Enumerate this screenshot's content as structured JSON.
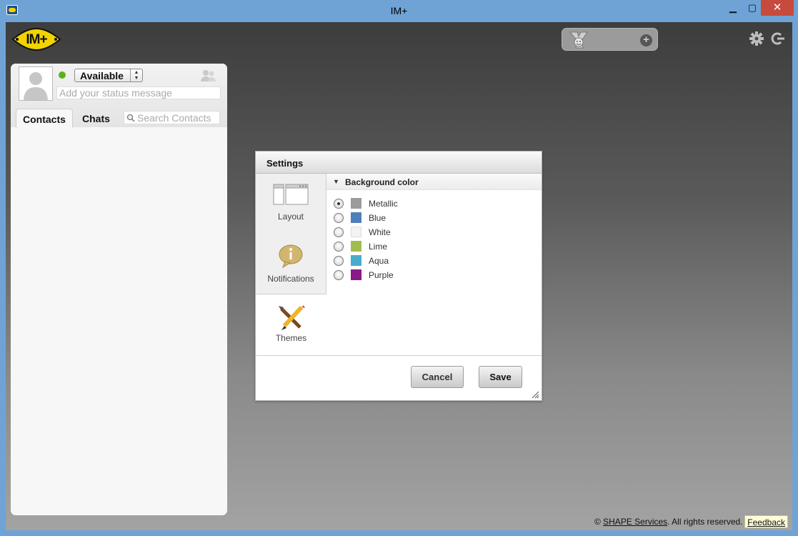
{
  "window": {
    "title": "IM+",
    "minimize_glyph": "▁",
    "maximize_glyph": "▢",
    "close_glyph": "✕"
  },
  "logo": {
    "text": "IM+"
  },
  "account": {
    "service_icon": "yahoo-messenger-icon",
    "add_icon": "plus-icon",
    "add_glyph": "+"
  },
  "toolbar": {
    "settings_icon": "gear-icon",
    "signout_icon": "signout-icon"
  },
  "profile": {
    "status": "Available",
    "status_color": "#5ab21b",
    "status_message_placeholder": "Add your status message"
  },
  "contacts_panel": {
    "tabs": [
      {
        "label": "Contacts",
        "active": true
      },
      {
        "label": "Chats",
        "active": false
      }
    ],
    "search_placeholder": "Search Contacts"
  },
  "settings": {
    "title": "Settings",
    "sidebar": [
      {
        "label": "Layout",
        "icon": "layout-icon"
      },
      {
        "label": "Notifications",
        "icon": "info-bubble-icon"
      },
      {
        "label": "Themes",
        "icon": "brush-pencil-icon",
        "active": true
      }
    ],
    "section_title": "Background color",
    "section_arrow": "▼",
    "options": [
      {
        "label": "Metallic",
        "color": "#9b9b9b",
        "selected": true
      },
      {
        "label": "Blue",
        "color": "#4f7fb8",
        "selected": false
      },
      {
        "label": "White",
        "color": "#f3f3f3",
        "selected": false
      },
      {
        "label": "Lime",
        "color": "#a2bd4f",
        "selected": false
      },
      {
        "label": "Aqua",
        "color": "#4aaccb",
        "selected": false
      },
      {
        "label": "Purple",
        "color": "#8a1a86",
        "selected": false
      }
    ],
    "cancel_label": "Cancel",
    "save_label": "Save"
  },
  "footer": {
    "copyright_symbol": "©",
    "company_link": "SHAPE Services",
    "rights_text": ". All rights reserved. |",
    "feedback_label": "Feedback"
  }
}
